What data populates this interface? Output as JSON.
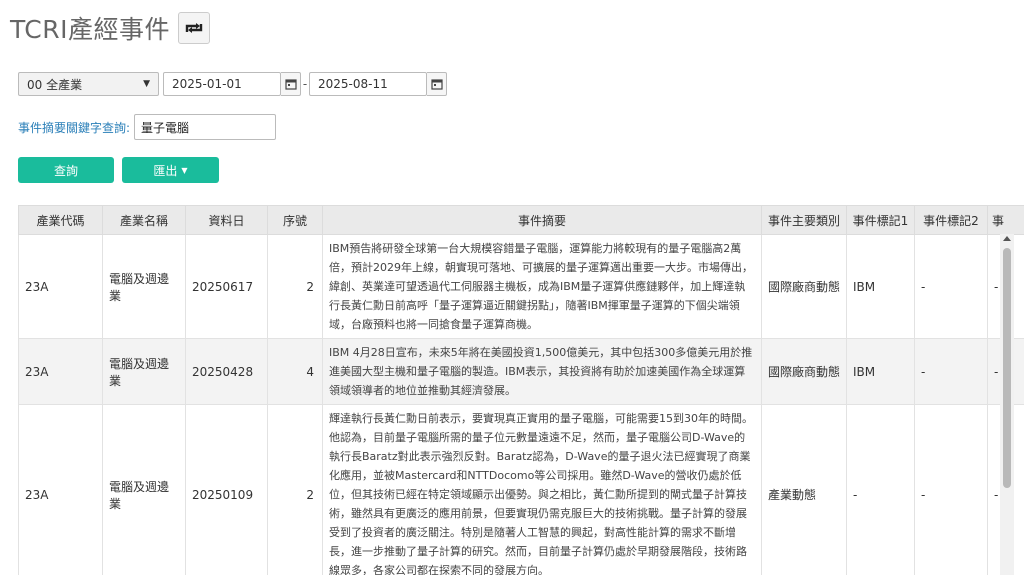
{
  "page": {
    "title": "TCRI產經事件"
  },
  "filters": {
    "industry_selected": "00 全產業",
    "date_from": "2025-01-01",
    "date_to": "2025-08-11",
    "date_separator": "-",
    "keyword_label": "事件摘要關鍵字查詢:",
    "keyword_value": "量子電腦"
  },
  "buttons": {
    "query": "查詢",
    "export": "匯出"
  },
  "table": {
    "headers": [
      "產業代碼",
      "產業名稱",
      "資料日",
      "序號",
      "事件摘要",
      "事件主要類別",
      "事件標記1",
      "事件標記2",
      "事"
    ],
    "rows": [
      {
        "code": "23A",
        "name": "電腦及週邊業",
        "date": "20250617",
        "seq": "2",
        "summary": "IBM預告將研發全球第一台大規模容錯量子電腦，運算能力將較現有的量子電腦高2萬倍，預計2029年上線，朝實現可落地、可擴展的量子運算邁出重要一大步。市場傳出，緯創、英業達可望透過代工伺服器主機板，成為IBM量子運算供應鏈夥伴，加上輝達執行長黃仁勳日前高呼「量子運算逼近關鍵拐點」，隨著IBM揮軍量子運算的下個尖端領域，台廠預料也將一同搶食量子運算商機。",
        "category": "國際廠商動態",
        "tag1": "IBM",
        "tag2": "-",
        "tag3": "-"
      },
      {
        "code": "23A",
        "name": "電腦及週邊業",
        "date": "20250428",
        "seq": "4",
        "summary": "IBM 4月28日宣布，未來5年將在美國投資1,500億美元，其中包括300多億美元用於推進美國大型主機和量子電腦的製造。IBM表示，其投資將有助於加速美國作為全球運算領域領導者的地位並推動其經濟發展。",
        "category": "國際廠商動態",
        "tag1": "IBM",
        "tag2": "-",
        "tag3": "-"
      },
      {
        "code": "23A",
        "name": "電腦及週邊業",
        "date": "20250109",
        "seq": "2",
        "summary": "輝達執行長黃仁勳日前表示，要實現真正實用的量子電腦，可能需要15到30年的時間。他認為，目前量子電腦所需的量子位元數量遠遠不足，然而，量子電腦公司D-Wave的執行長Baratz對此表示強烈反對。Baratz認為，D-Wave的量子退火法已經實現了商業化應用，並被Mastercard和NTTDocomo等公司採用。雖然D-Wave的營收仍處於低位，但其技術已經在特定領域顯示出優勢。與之相比，黃仁勳所提到的閘式量子計算技術，雖然具有更廣泛的應用前景，但要實現仍需克服巨大的技術挑戰。量子計算的發展受到了投資者的廣泛關注。特別是隨著人工智慧的興起，對高性能計算的需求不斷增長，進一步推動了量子計算的研究。然而，目前量子計算仍處於早期發展階段，技術路線眾多，各家公司都在探索不同的發展方向。",
        "category": "產業動態",
        "tag1": "-",
        "tag2": "-",
        "tag3": "-"
      }
    ]
  }
}
